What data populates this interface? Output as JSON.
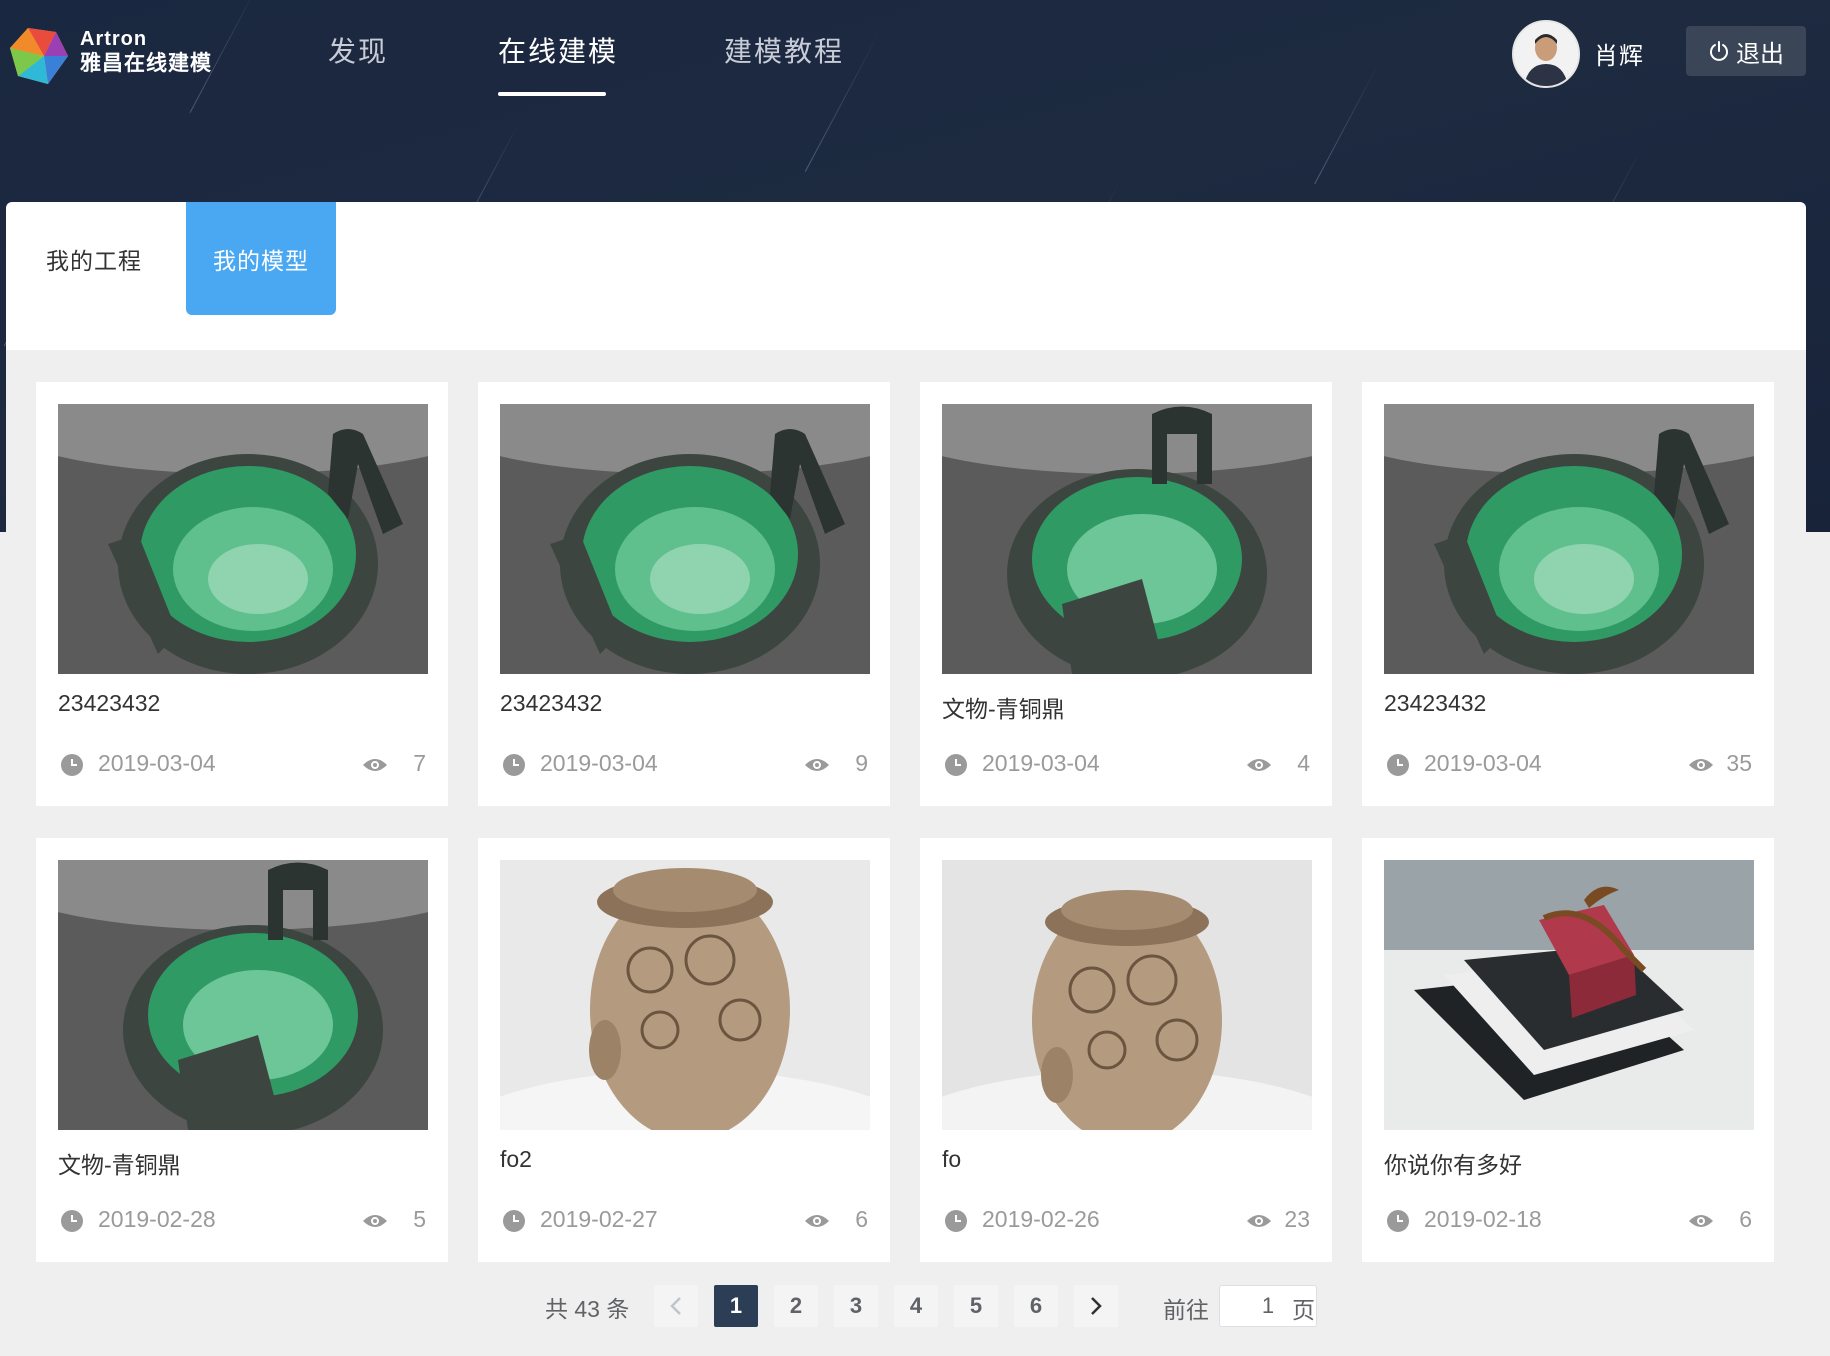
{
  "brand": {
    "en": "Artron",
    "cn": "雅昌在线建模"
  },
  "nav": {
    "items": [
      "发现",
      "在线建模",
      "建模教程"
    ],
    "active": "在线建模"
  },
  "user": {
    "name": "肖辉",
    "logout_label": "退出"
  },
  "tabs": {
    "items": [
      "我的工程",
      "我的模型"
    ],
    "active": "我的模型"
  },
  "models": [
    {
      "title": "23423432",
      "date": "2019-03-04",
      "views": "7",
      "image": "bronze-ding"
    },
    {
      "title": "23423432",
      "date": "2019-03-04",
      "views": "9",
      "image": "bronze-ding"
    },
    {
      "title": "文物-青铜鼎",
      "date": "2019-03-04",
      "views": "4",
      "image": "bronze-ding-alt"
    },
    {
      "title": "23423432",
      "date": "2019-03-04",
      "views": "35",
      "image": "bronze-ding"
    },
    {
      "title": "文物-青铜鼎",
      "date": "2019-02-28",
      "views": "5",
      "image": "bronze-ding-alt"
    },
    {
      "title": "fo2",
      "date": "2019-02-27",
      "views": "6",
      "image": "buddha-head"
    },
    {
      "title": "fo",
      "date": "2019-02-26",
      "views": "23",
      "image": "buddha-head"
    },
    {
      "title": "你说你有多好",
      "date": "2019-02-18",
      "views": "6",
      "image": "gift-books"
    }
  ],
  "pagination": {
    "total_label": "共 43 条",
    "pages": [
      "1",
      "2",
      "3",
      "4",
      "5",
      "6"
    ],
    "current": "1",
    "goto_label": "前往",
    "goto_value": "1",
    "page_suffix": "页"
  },
  "colors": {
    "accent": "#4aa8f3",
    "header_bg": "#1a2740",
    "active_page": "#2c3e55"
  }
}
